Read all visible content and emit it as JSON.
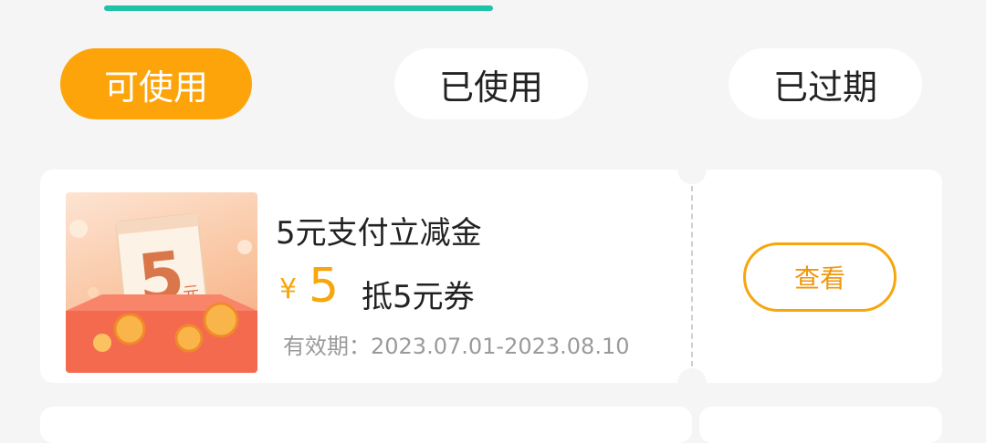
{
  "filters": {
    "available": "可使用",
    "used": "已使用",
    "expired": "已过期"
  },
  "coupon": {
    "title": "5元支付立减金",
    "currency": "¥",
    "amount": "5",
    "deduct_text": "抵5元券",
    "validity": "有效期：2023.07.01-2023.08.10",
    "view_button": "查看",
    "thumbnail_amount": "5",
    "thumbnail_unit": "元"
  },
  "colors": {
    "accent": "#fca40a",
    "tab_indicator": "#1ec2a7",
    "price": "#f7a60d"
  }
}
